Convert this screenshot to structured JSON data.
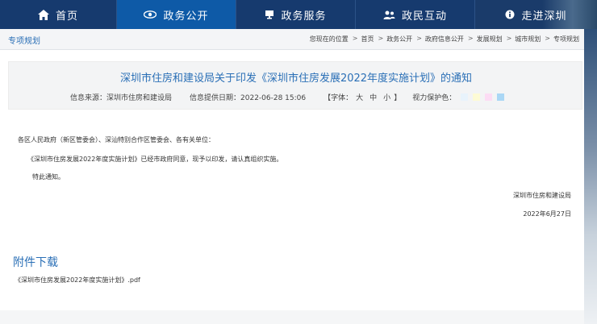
{
  "nav": {
    "items": [
      {
        "label": "首页",
        "icon": "home-icon"
      },
      {
        "label": "政务公开",
        "icon": "eye-icon"
      },
      {
        "label": "政务服务",
        "icon": "monitor-icon"
      },
      {
        "label": "政民互动",
        "icon": "people-icon"
      },
      {
        "label": "走进深圳",
        "icon": "info-circle-icon"
      }
    ]
  },
  "breadcrumb": {
    "section_title": "专项规划",
    "prefix": "您现在的位置",
    "items": [
      "首页",
      "政务公开",
      "政府信息公开",
      "发展规划",
      "城市规划",
      "专项规划"
    ],
    "separator": ">"
  },
  "article": {
    "title": "深圳市住房和建设局关于印发《深圳市住房发展2022年度实施计划》的通知",
    "source_label": "信息来源：深圳市住房和建设局",
    "date_label": "信息提供日期：2022-06-28 15:06",
    "font_label": "【字体：",
    "font_large": "大",
    "font_medium": "中",
    "font_small": "小",
    "font_close": "】",
    "vision_label": "视力保护色：",
    "vision_colors": [
      "#e8f3fc",
      "#fdfbd5",
      "#fcdcf4",
      "#aad7f5"
    ],
    "body": {
      "addressee": "各区人民政府（新区管委会）、深汕特别合作区管委会、各有关单位：",
      "paragraph": "《深圳市住房发展2022年度实施计划》已经市政府同意，现予以印发，请认真组织实施。",
      "closing": "特此通知。",
      "signature": "深圳市住房和建设局",
      "date": "2022年6月27日"
    }
  },
  "attachments": {
    "title": "附件下载",
    "files": [
      "《深圳市住房发展2022年度实施计划》.pdf"
    ]
  }
}
